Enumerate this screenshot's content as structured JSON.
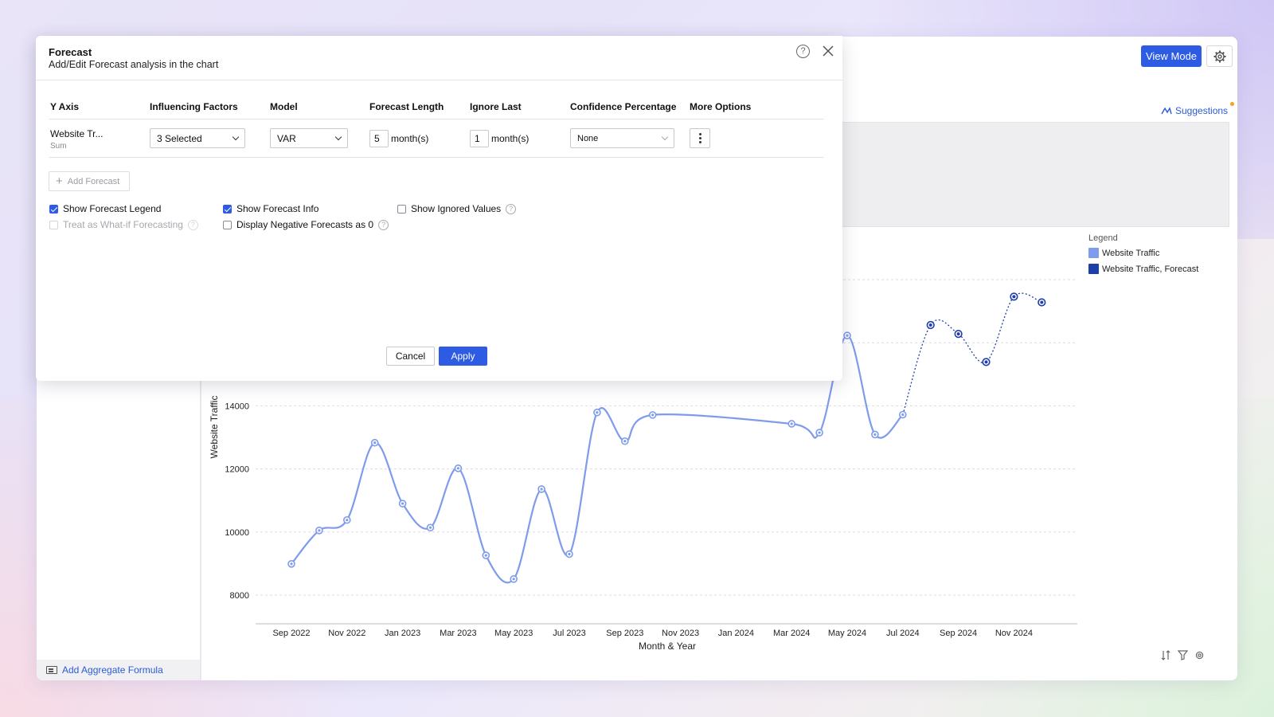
{
  "dialog": {
    "title": "Forecast",
    "subtitle": "Add/Edit Forecast analysis in the chart",
    "columns": {
      "y_axis": "Y Axis",
      "influencing_factors": "Influencing Factors",
      "model": "Model",
      "forecast_length": "Forecast Length",
      "ignore_last": "Ignore Last",
      "confidence_percentage": "Confidence Percentage",
      "more_options": "More Options"
    },
    "row": {
      "y_axis_name": "Website Tr...",
      "y_axis_aggregate": "Sum",
      "influencing_factors": "3 Selected",
      "model": "VAR",
      "forecast_length": "5",
      "forecast_length_unit": "month(s)",
      "ignore_last": "1",
      "ignore_last_unit": "month(s)",
      "confidence": "None"
    },
    "add_forecast": "Add Forecast",
    "options": {
      "show_forecast_legend": "Show Forecast Legend",
      "treat_as_whatif": "Treat as What-if Forecasting",
      "show_forecast_info": "Show Forecast Info",
      "display_negative": "Display Negative Forecasts as 0",
      "show_ignored": "Show Ignored Values"
    },
    "cancel": "Cancel",
    "apply": "Apply"
  },
  "toolbar": {
    "view_mode": "View Mode",
    "suggestions": "Suggestions"
  },
  "sidebar": {
    "add_aggregate_formula": "Add Aggregate Formula"
  },
  "legend": {
    "title": "Legend",
    "items": [
      {
        "label": "Website Traffic",
        "color": "#7e9bec"
      },
      {
        "label": "Website Traffic, Forecast",
        "color": "#1f3fa8"
      }
    ]
  },
  "chart_data": {
    "type": "line",
    "xlabel": "Month & Year",
    "ylabel": "Website Traffic",
    "x_ticks": [
      "Sep 2022",
      "Nov 2022",
      "Jan 2023",
      "Mar 2023",
      "May 2023",
      "Jul 2023",
      "Sep 2023",
      "Nov 2023",
      "Jan 2024",
      "Mar 2024",
      "May 2024",
      "Jul 2024",
      "Sep 2024",
      "Nov 2024"
    ],
    "y_ticks": [
      8000,
      10000,
      12000,
      14000
    ],
    "series": [
      {
        "name": "Website Traffic",
        "color": "#7e9bec",
        "points": [
          {
            "x": "Sep 2022",
            "y": 8990
          },
          {
            "x": "Oct 2022",
            "y": 10050
          },
          {
            "x": "Nov 2022",
            "y": 10380
          },
          {
            "x": "Dec 2022",
            "y": 12830
          },
          {
            "x": "Jan 2023",
            "y": 10900
          },
          {
            "x": "Feb 2023",
            "y": 10140
          },
          {
            "x": "Mar 2023",
            "y": 12020
          },
          {
            "x": "Apr 2023",
            "y": 9260
          },
          {
            "x": "May 2023",
            "y": 8510
          },
          {
            "x": "Jun 2023",
            "y": 11360
          },
          {
            "x": "Jul 2023",
            "y": 9300
          },
          {
            "x": "Aug 2023",
            "y": 13790
          },
          {
            "x": "Sep 2023",
            "y": 12880
          },
          {
            "x": "Oct 2023",
            "y": 13710
          },
          {
            "x": "Mar 2024",
            "y": 13430
          },
          {
            "x": "Apr 2024",
            "y": 13150
          },
          {
            "x": "May 2024",
            "y": 16230
          },
          {
            "x": "Jun 2024",
            "y": 13090
          },
          {
            "x": "Jul 2024",
            "y": 13720
          }
        ]
      },
      {
        "name": "Website Traffic, Forecast",
        "color": "#1f3fa8",
        "points": [
          {
            "x": "Aug 2024",
            "y": 16560
          },
          {
            "x": "Sep 2024",
            "y": 16280
          },
          {
            "x": "Oct 2024",
            "y": 15390
          },
          {
            "x": "Nov 2024",
            "y": 17460
          },
          {
            "x": "Dec 2024",
            "y": 17280
          }
        ]
      }
    ]
  }
}
